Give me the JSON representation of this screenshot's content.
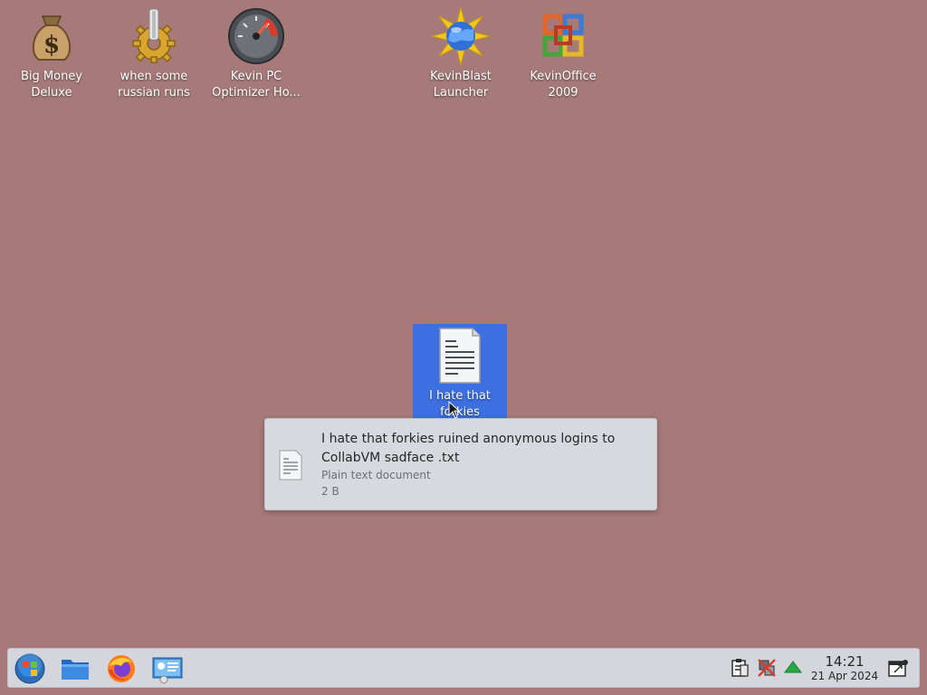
{
  "desktop": {
    "background_color": "#a57a78",
    "icons": [
      {
        "label": "Big Money Deluxe",
        "icon": "money-bag-icon"
      },
      {
        "label": "when some russian runs a...",
        "icon": "gear-icon"
      },
      {
        "label": "Kevin PC Optimizer Ho...",
        "icon": "gauge-icon"
      },
      {
        "label": "KevinBlast Launcher",
        "icon": "globe-burst-icon"
      },
      {
        "label": "KevinOffice 2009",
        "icon": "office-logo-icon"
      },
      {
        "label": "I hate that forkies ruined...",
        "icon": "text-document-icon",
        "selected": true
      }
    ]
  },
  "tooltip": {
    "title": "I hate that forkies ruined anonymous logins to CollabVM sadface .txt",
    "type": "Plain text document",
    "size": "2 B",
    "icon": "text-document-icon"
  },
  "taskbar": {
    "launchers": [
      {
        "name": "start-menu",
        "icon": "windows-orb-icon"
      },
      {
        "name": "file-manager",
        "icon": "folder-icon"
      },
      {
        "name": "firefox",
        "icon": "firefox-icon"
      },
      {
        "name": "control-panel",
        "icon": "system-settings-icon"
      }
    ],
    "tray": [
      {
        "name": "clipboard",
        "icon": "clipboard-icon"
      },
      {
        "name": "network-disconnected",
        "icon": "network-off-icon"
      },
      {
        "name": "updates",
        "icon": "up-arrow-icon"
      }
    ],
    "clock": {
      "time": "14:21",
      "date": "21 Apr 2024"
    },
    "show_desktop": "show-desktop-icon"
  }
}
